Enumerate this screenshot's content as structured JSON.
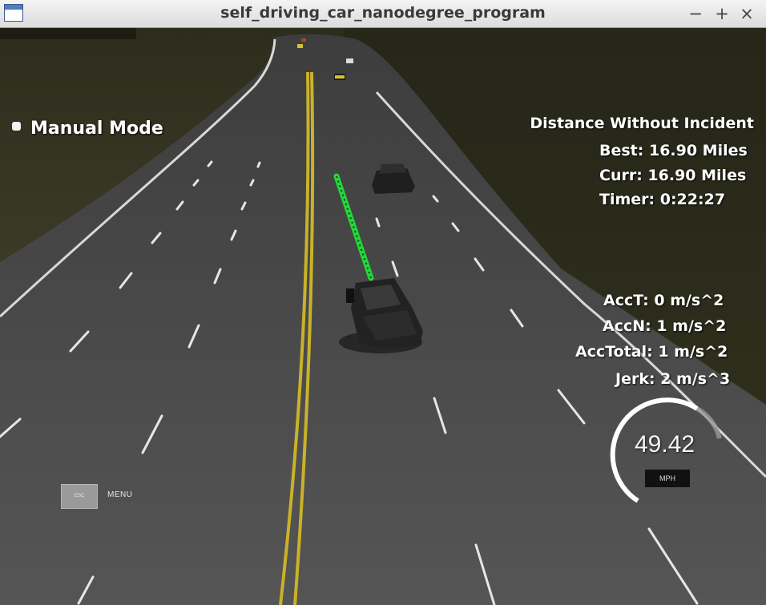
{
  "window": {
    "title": "self_driving_car_nanodegree_program",
    "controls": {
      "minimize": "−",
      "maximize": "+",
      "close": "×"
    }
  },
  "hud": {
    "mode": "Manual Mode",
    "distance_title": "Distance Without Incident",
    "best": "Best: 16.90 Miles",
    "curr": "Curr: 16.90 Miles",
    "timer": "Timer: 0:22:27",
    "acc_t": "AccT: 0 m/s^2",
    "acc_n": "AccN: 1 m/s^2",
    "acc_total": "AccTotal: 1 m/s^2",
    "jerk": "Jerk: 2 m/s^3"
  },
  "menu": {
    "esc_label": "ESC",
    "menu_label": "MENU"
  },
  "speedometer": {
    "value": "49.42",
    "unit": "MPH"
  },
  "colors": {
    "grass": "#2d2f1e",
    "road": "#505050",
    "center_line": "#c9b22a",
    "lane_marking": "#e6e6e6",
    "planned_path": "#23d63a",
    "gauge_arc": "#ffffff"
  }
}
